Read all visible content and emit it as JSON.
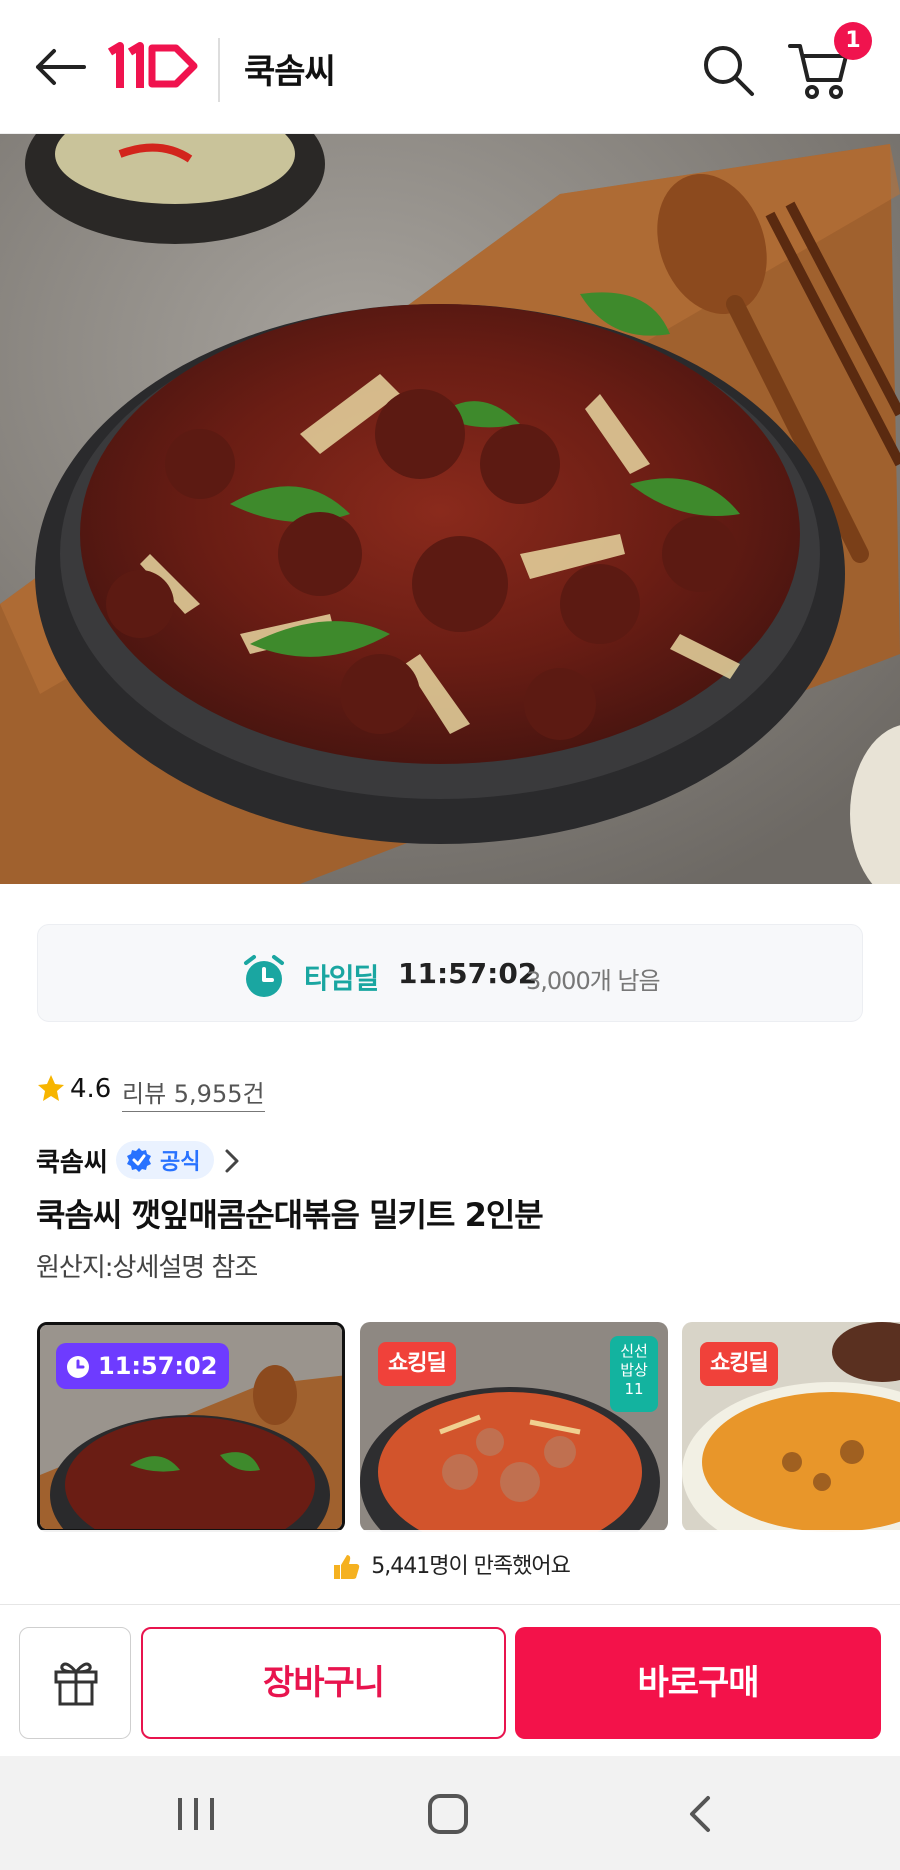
{
  "header": {
    "title": "쿡솜씨",
    "cart_count": "1",
    "logo_text": "11"
  },
  "time_deal": {
    "label": "타임딜",
    "time": "11:57:02",
    "remaining": "3,000개 남음"
  },
  "rating": {
    "value": "4.6",
    "review_text": "리뷰 5,955건"
  },
  "seller": {
    "name": "쿡솜씨",
    "badge": "공식"
  },
  "product": {
    "title": "쿡솜씨 깻잎매콤순대볶음 밀키트 2인분",
    "origin": "원산지:상세설명 참조"
  },
  "thumbnails": [
    {
      "badge": "11:57:02",
      "badge_type": "timedeal"
    },
    {
      "badge": "쇼킹딜",
      "badge_type": "shocking",
      "side_badge_lines": [
        "신선",
        "밥상",
        "11"
      ]
    },
    {
      "badge": "쇼킹딜",
      "badge_type": "shocking"
    }
  ],
  "satisfaction": {
    "text": "5,441명이 만족했어요"
  },
  "actions": {
    "cart_label": "장바구니",
    "buy_label": "바로구매"
  },
  "colors": {
    "accent": "#f3124a",
    "timedeal": "#1aa6a1",
    "official": "#2872ff",
    "deal_purple": "#6e3bff",
    "shocking_red": "#f0413a"
  }
}
